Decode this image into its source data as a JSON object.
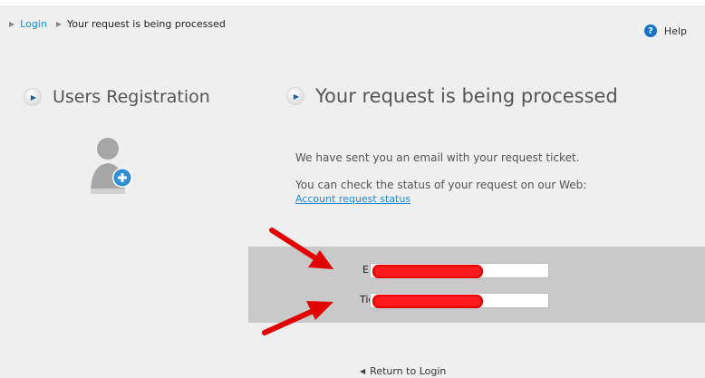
{
  "breadcrumb": {
    "login_label": "Login",
    "current_label": "Your request is being processed"
  },
  "help_label": "Help",
  "left": {
    "title": "Users Registration",
    "icon": "user-add-icon"
  },
  "main": {
    "title": "Your request is being processed",
    "message1": "We have sent you an email with your request ticket.",
    "message2": "You can check the status of your request on our Web:",
    "status_link": "Account request status"
  },
  "form": {
    "email_label": "Email:",
    "ticket_label": "Ticket:",
    "email_value": "",
    "ticket_value": ""
  },
  "return_label": "Return to Login",
  "colors": {
    "accent": "#1f8ad6",
    "annotation": "#e00000",
    "form_background": "#c9c9c9",
    "page_background": "#efefef"
  }
}
